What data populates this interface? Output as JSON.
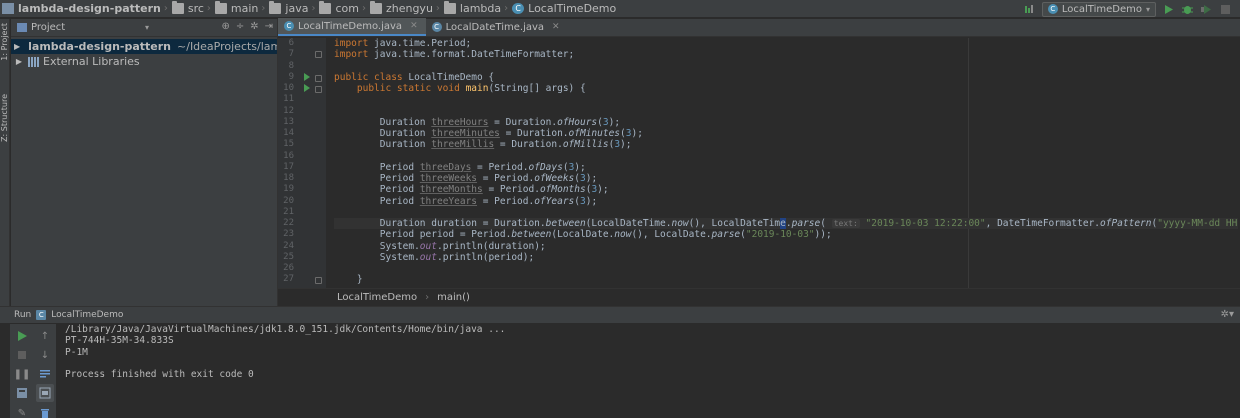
{
  "navbar": {
    "crumbs": [
      "lambda-design-pattern",
      "src",
      "main",
      "java",
      "com",
      "zhengyu",
      "lambda",
      "LocalTimeDemo"
    ],
    "run_config": "LocalTimeDemo"
  },
  "left_strip": {
    "project_tab": "1: Project",
    "structure_tab": "Z: Structure"
  },
  "project_panel": {
    "title": "Project",
    "tree": [
      {
        "name": "lambda-design-pattern",
        "path": "~/IdeaProjects/lambda-de"
      },
      {
        "name": "External Libraries",
        "path": ""
      }
    ]
  },
  "editor": {
    "tabs": [
      {
        "label": "LocalTimeDemo.java",
        "active": true
      },
      {
        "label": "LocalDateTime.java",
        "active": false
      }
    ],
    "line_numbers": [
      "6",
      "7",
      "8",
      "9",
      "10",
      "11",
      "12",
      "13",
      "14",
      "15",
      "16",
      "17",
      "18",
      "19",
      "20",
      "21",
      "22",
      "23",
      "24",
      "25",
      "26",
      "27"
    ],
    "code": {
      "l6_kw": "import",
      "l6_rest": " java.time.Period;",
      "l7_kw": "import",
      "l7_rest": " java.time.format.DateTimeFormatter;",
      "l9_kw1": "public class",
      "l9_rest": " LocalTimeDemo {",
      "l10_indent": "    ",
      "l10_kw": "public static void",
      "l10_fn": "main",
      "l10_rest": "(String[] args) {",
      "l13_indent": "        ",
      "l13_type": "Duration ",
      "l13_var": "threeHours",
      "l13_eq": " = Duration.",
      "l13_fn": "ofHours",
      "l13_open": "(",
      "l13_num": "3",
      "l13_close": ");",
      "l14_indent": "        ",
      "l14_type": "Duration ",
      "l14_var": "threeMinutes",
      "l14_eq": " = Duration.",
      "l14_fn": "ofMinutes",
      "l14_open": "(",
      "l14_num": "3",
      "l14_close": ");",
      "l15_indent": "        ",
      "l15_type": "Duration ",
      "l15_var": "threeMillis",
      "l15_eq": " = Duration.",
      "l15_fn": "ofMillis",
      "l15_open": "(",
      "l15_num": "3",
      "l15_close": ");",
      "l17_indent": "        ",
      "l17_type": "Period ",
      "l17_var": "threeDays",
      "l17_eq": " = Period.",
      "l17_fn": "ofDays",
      "l17_open": "(",
      "l17_num": "3",
      "l17_close": ");",
      "l18_indent": "        ",
      "l18_type": "Period ",
      "l18_var": "threeWeeks",
      "l18_eq": " = Period.",
      "l18_fn": "ofWeeks",
      "l18_open": "(",
      "l18_num": "3",
      "l18_close": ");",
      "l19_indent": "        ",
      "l19_type": "Period ",
      "l19_var": "threeMonths",
      "l19_eq": " = Period.",
      "l19_fn": "ofMonths",
      "l19_open": "(",
      "l19_num": "3",
      "l19_close": ");",
      "l20_indent": "        ",
      "l20_type": "Period ",
      "l20_var": "threeYears",
      "l20_eq": " = Period.",
      "l20_fn": "ofYears",
      "l20_open": "(",
      "l20_num": "3",
      "l20_close": ");",
      "l22_a": "        Duration duration = Duration.",
      "l22_fn1": "between",
      "l22_b": "(LocalDateTime.",
      "l22_fn2": "now",
      "l22_c": "(), LocalDateTim",
      "l22_caret": "e",
      "l22_d": ".",
      "l22_fn3": "parse",
      "l22_e": "( ",
      "l22_hint": "text:",
      "l22_str1": " \"2019-10-03 12:22:00\"",
      "l22_f": ", DateTimeFormatter.",
      "l22_fn4": "ofPattern",
      "l22_g": "(",
      "l22_str2": "\"yyyy-MM-dd HH:mm:ss\"",
      "l22_h": ")));",
      "l23_a": "        Period period = Period.",
      "l23_fn1": "between",
      "l23_b": "(LocalDate.",
      "l23_fn2": "now",
      "l23_c": "(), LocalDate.",
      "l23_fn3": "parse",
      "l23_d": "(",
      "l23_str": "\"2019-10-03\"",
      "l23_e": "));",
      "l24_a": "        System.",
      "l24_out": "out",
      "l24_b": ".println(duration);",
      "l25_a": "        System.",
      "l25_out": "out",
      "l25_b": ".println(period);",
      "l27": "    }"
    },
    "breadcrumb": [
      "LocalTimeDemo",
      "main()"
    ]
  },
  "run_panel": {
    "label": "Run",
    "config": "LocalTimeDemo",
    "console": [
      "/Library/Java/JavaVirtualMachines/jdk1.8.0_151.jdk/Contents/Home/bin/java ...",
      "PT-744H-35M-34.833S",
      "P-1M",
      "",
      "Process finished with exit code 0"
    ]
  },
  "colors": {
    "keyword": "#cc7832",
    "method": "#ffc66d",
    "string": "#6a8759",
    "number": "#6897bb",
    "field": "#9876aa",
    "run_green": "#499c54",
    "accent": "#4a88c7"
  },
  "icons": [
    "folder-icon",
    "class-icon",
    "run-icon",
    "debug-icon",
    "coverage-icon",
    "stop-icon",
    "gear-icon",
    "collapse-icon",
    "locate-icon"
  ]
}
